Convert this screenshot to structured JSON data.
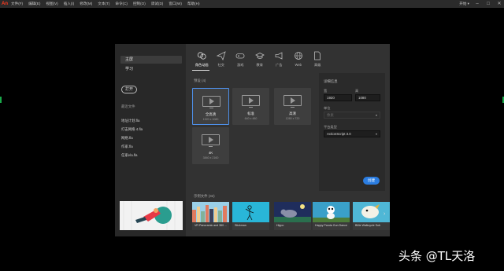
{
  "app": {
    "logo": "An"
  },
  "menu": [
    "文件(F)",
    "编辑(E)",
    "视图(V)",
    "插入(I)",
    "修改(M)",
    "文本(T)",
    "命令(C)",
    "控制(O)",
    "调试(D)",
    "窗口(W)",
    "帮助(H)"
  ],
  "menubar_right": {
    "workspace": "开始 ▾",
    "minimize": "–",
    "maximize": "□",
    "close": "✕"
  },
  "left": {
    "home_label": "主屏",
    "learn_label": "学习",
    "open_button": "打开",
    "recent_title": "最近文件",
    "recent_files": [
      "地址计划.fla",
      "打击网络 4.fla",
      "网络.fla",
      "作家.fla",
      "任家ela.fla"
    ]
  },
  "categories": [
    {
      "icon": "character-animation-icon",
      "label": "角色动画",
      "active": true
    },
    {
      "icon": "social-icon",
      "label": "社交",
      "active": false
    },
    {
      "icon": "game-icon",
      "label": "游戏",
      "active": false
    },
    {
      "icon": "education-icon",
      "label": "教育",
      "active": false
    },
    {
      "icon": "advertising-icon",
      "label": "广告",
      "active": false
    },
    {
      "icon": "web-icon",
      "label": "Web",
      "active": false
    },
    {
      "icon": "advanced-icon",
      "label": "高级",
      "active": false
    }
  ],
  "presets": {
    "title": "预设 (4)",
    "items": [
      {
        "name": "全高清",
        "size": "1920 x 1080",
        "selected": true
      },
      {
        "name": "标准",
        "size": "640 x 480",
        "selected": false
      },
      {
        "name": "高清",
        "size": "1280 x 720",
        "selected": false
      },
      {
        "name": "4K",
        "size": "3840 x 2160",
        "selected": false
      }
    ]
  },
  "details": {
    "title": "详细信息",
    "width_label": "宽",
    "height_label": "高",
    "width_value": "1920",
    "height_value": "1080",
    "unit_label": "单位",
    "unit_value": "像素",
    "platform_label": "平台类型",
    "platform_value": "ActionScript 3.0",
    "create_button": "创建"
  },
  "samples": {
    "title": "示例文件 (32)",
    "items": [
      "VR Panoramic and 360 ...",
      "Stickman",
      "Hippo",
      "Happy Panda Gun Dance",
      "Billie Walkcycle Sub"
    ]
  },
  "watermark": "头条 @TL天洛",
  "colors": {
    "accent": "#2b7de1",
    "selected_border": "#4e8fe8",
    "logo": "#ff3a1f"
  }
}
